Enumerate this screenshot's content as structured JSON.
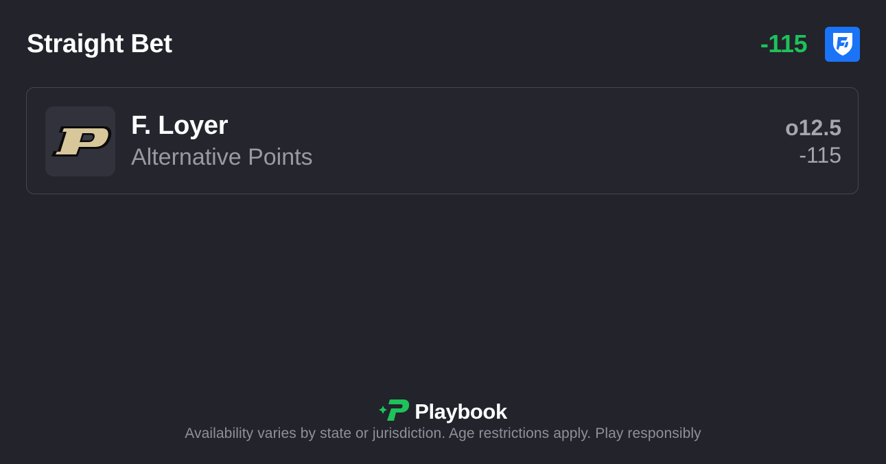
{
  "header": {
    "title": "Straight Bet",
    "odds": "-115",
    "sportsbook_icon": "fanduel-logo-icon"
  },
  "bet": {
    "team_icon": "purdue-p-logo-icon",
    "player": "F. Loyer",
    "market": "Alternative Points",
    "line": "o12.5",
    "odds": "-115"
  },
  "footer": {
    "brand_icon": "playbook-logo-icon",
    "brand": "Playbook",
    "disclaimer": "Availability varies by state or jurisdiction. Age restrictions apply. Play responsibly"
  },
  "colors": {
    "background": "#22232b",
    "accent_green": "#1ec15a",
    "sportsbook_blue": "#1a74f5",
    "purdue_gold": "#cfb991"
  }
}
